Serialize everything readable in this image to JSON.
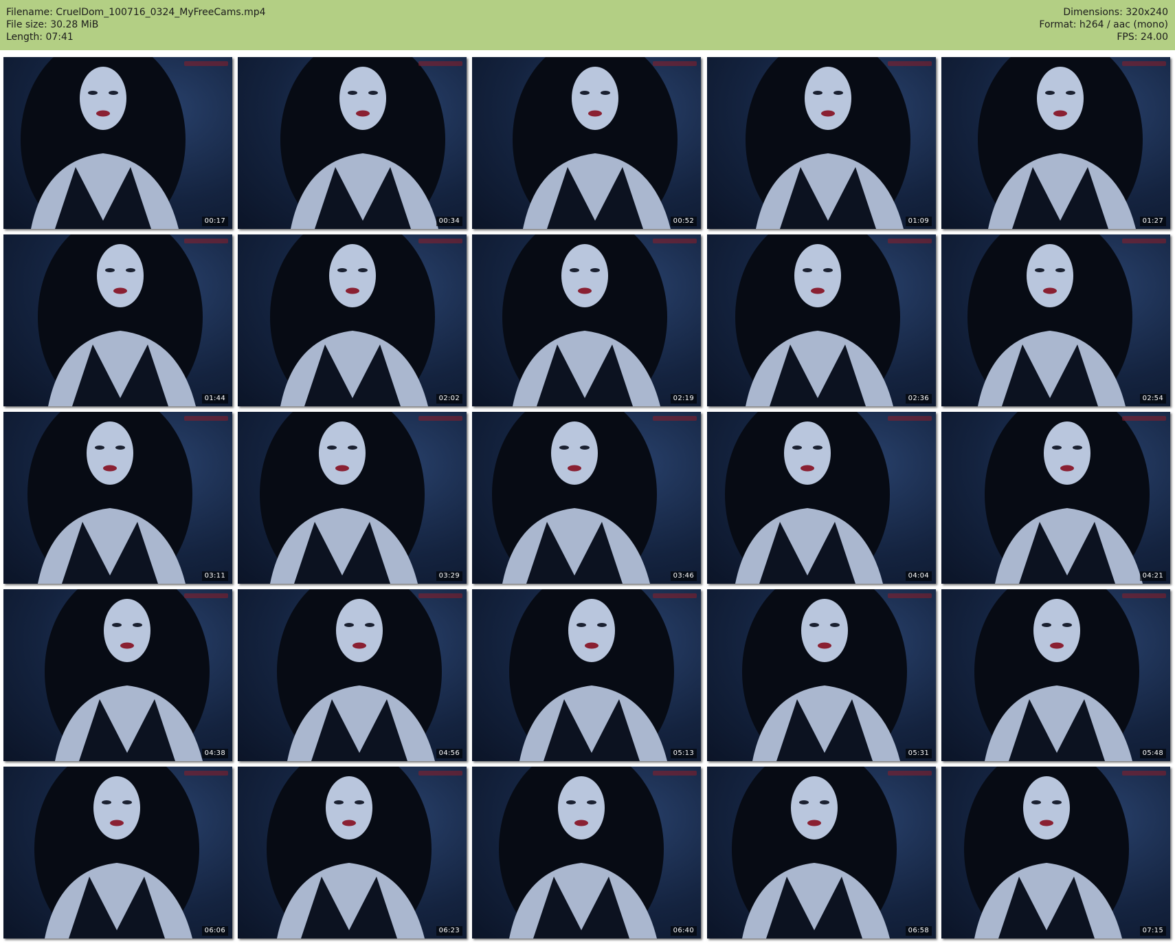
{
  "header": {
    "filename_label": "Filename: CruelDom_100716_0324_MyFreeCams.mp4",
    "filesize_label": "File size: 30.28 MiB",
    "length_label": "Length: 07:41",
    "dimensions_label": "Dimensions: 320x240",
    "format_label": "Format: h264 / aac (mono)",
    "fps_label": "FPS: 24.00",
    "background_color": "#b3cf84"
  },
  "thumbnails": [
    {
      "timestamp": "00:17"
    },
    {
      "timestamp": "00:34"
    },
    {
      "timestamp": "00:52"
    },
    {
      "timestamp": "01:09"
    },
    {
      "timestamp": "01:27"
    },
    {
      "timestamp": "01:44"
    },
    {
      "timestamp": "02:02"
    },
    {
      "timestamp": "02:19"
    },
    {
      "timestamp": "02:36"
    },
    {
      "timestamp": "02:54"
    },
    {
      "timestamp": "03:11"
    },
    {
      "timestamp": "03:29"
    },
    {
      "timestamp": "03:46"
    },
    {
      "timestamp": "04:04"
    },
    {
      "timestamp": "04:21"
    },
    {
      "timestamp": "04:38"
    },
    {
      "timestamp": "04:56"
    },
    {
      "timestamp": "05:13"
    },
    {
      "timestamp": "05:31"
    },
    {
      "timestamp": "05:48"
    },
    {
      "timestamp": "06:06"
    },
    {
      "timestamp": "06:23"
    },
    {
      "timestamp": "06:40"
    },
    {
      "timestamp": "06:58"
    },
    {
      "timestamp": "07:15"
    }
  ]
}
